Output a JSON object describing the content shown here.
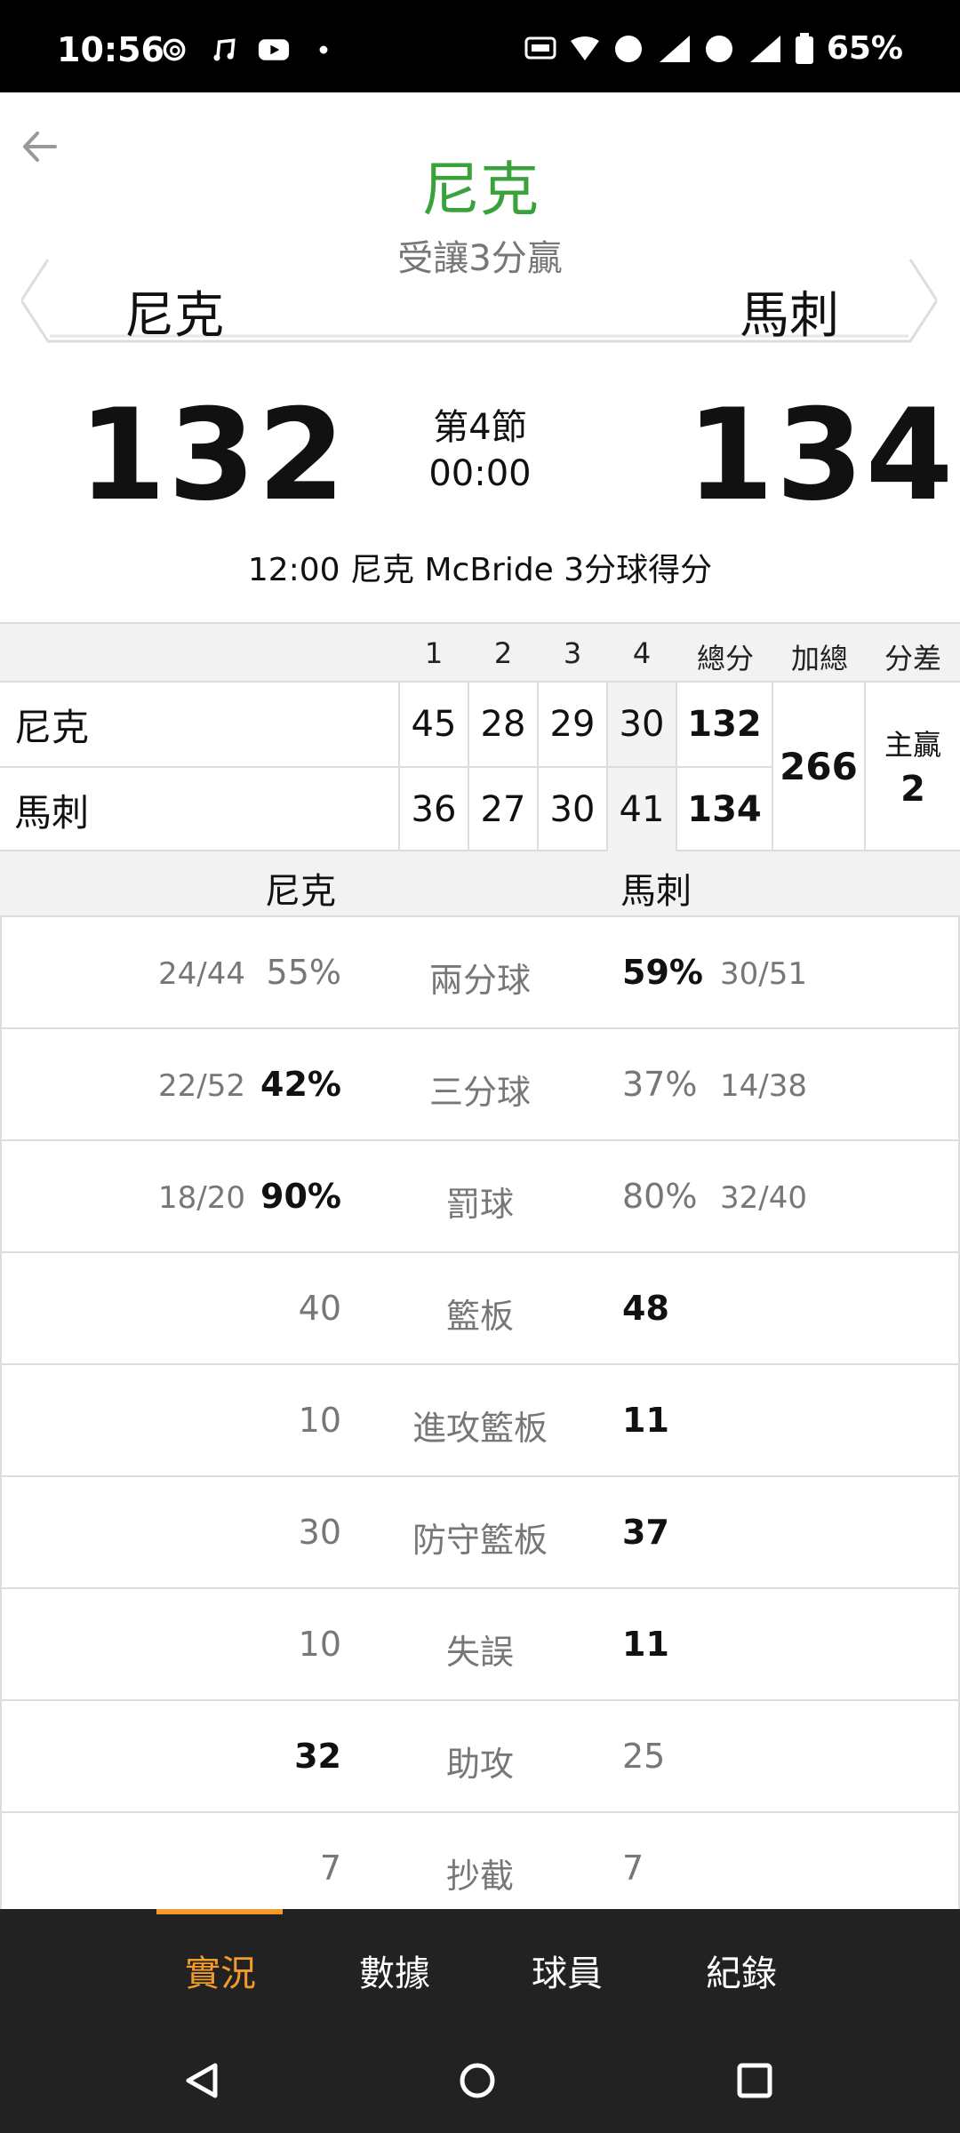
{
  "status_bar": {
    "time": "10:56",
    "battery": "65%",
    "left_icons": [
      "threads-icon",
      "music-icon",
      "youtube-icon",
      "dot-icon"
    ],
    "right_icons": [
      "auto-hz-icon",
      "wifi6-icon",
      "volte-icon",
      "signal-1-icon",
      "volte-icon",
      "signal-2-icon",
      "battery-icon"
    ],
    "sim1": "1",
    "sim2": "2"
  },
  "header": {
    "headline": "尼克",
    "handicap": "受讓3分贏",
    "team_left": "尼克",
    "team_right": "馬刺",
    "score_left": "132",
    "score_right": "134",
    "period": "第4節",
    "clock": "00:00",
    "last_play": "12:00 尼克 McBride 3分球得分"
  },
  "quarter_table": {
    "headers": [
      "1",
      "2",
      "3",
      "4",
      "總分",
      "加總",
      "分差"
    ],
    "rows": [
      {
        "team": "尼克",
        "q": [
          "45",
          "28",
          "29",
          "30"
        ],
        "total": "132"
      },
      {
        "team": "馬刺",
        "q": [
          "36",
          "27",
          "30",
          "41"
        ],
        "total": "134"
      }
    ],
    "sum": "266",
    "diff_label": "主贏",
    "diff_value": "2"
  },
  "stats": {
    "team_left": "尼克",
    "team_right": "馬刺",
    "rows": [
      {
        "name": "兩分球",
        "left_att": "24/44",
        "left": "55%",
        "right": "59%",
        "right_att": "30/51",
        "bold": "right"
      },
      {
        "name": "三分球",
        "left_att": "22/52",
        "left": "42%",
        "right": "37%",
        "right_att": "14/38",
        "bold": "left"
      },
      {
        "name": "罰球",
        "left_att": "18/20",
        "left": "90%",
        "right": "80%",
        "right_att": "32/40",
        "bold": "left"
      },
      {
        "name": "籃板",
        "left_att": "",
        "left": "40",
        "right": "48",
        "right_att": "",
        "bold": "right"
      },
      {
        "name": "進攻籃板",
        "left_att": "",
        "left": "10",
        "right": "11",
        "right_att": "",
        "bold": "right"
      },
      {
        "name": "防守籃板",
        "left_att": "",
        "left": "30",
        "right": "37",
        "right_att": "",
        "bold": "right"
      },
      {
        "name": "失誤",
        "left_att": "",
        "left": "10",
        "right": "11",
        "right_att": "",
        "bold": "right"
      },
      {
        "name": "助攻",
        "left_att": "",
        "left": "32",
        "right": "25",
        "right_att": "",
        "bold": "left"
      },
      {
        "name": "抄截",
        "left_att": "",
        "left": "7",
        "right": "7",
        "right_att": "",
        "bold": "none"
      }
    ]
  },
  "tabs": [
    {
      "label": "實況",
      "active": true
    },
    {
      "label": "數據",
      "active": false
    },
    {
      "label": "球員",
      "active": false
    },
    {
      "label": "紀錄",
      "active": false
    }
  ],
  "colors": {
    "headline": "#3aa23a",
    "accent": "#f39c2b",
    "tabbar": "#222222"
  }
}
